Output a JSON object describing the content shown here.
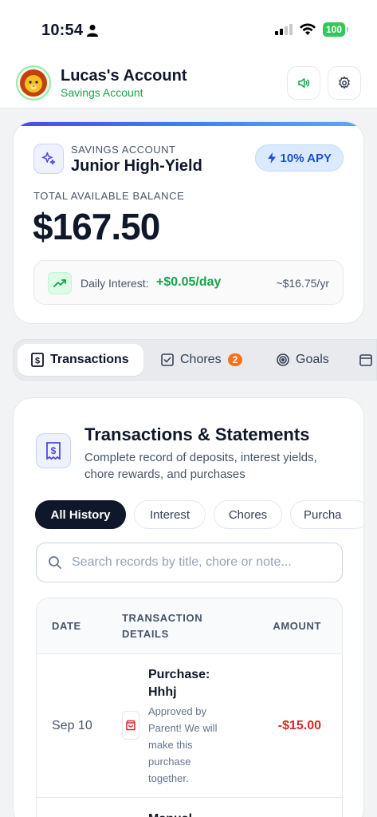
{
  "status_bar": {
    "time": "10:54",
    "battery": "100"
  },
  "header": {
    "account_name": "Lucas's Account",
    "account_type": "Savings Account"
  },
  "balance_card": {
    "label": "SAVINGS ACCOUNT",
    "name": "Junior High-Yield",
    "apy": "10% APY",
    "balance_label": "TOTAL AVAILABLE BALANCE",
    "balance": "$167.50",
    "daily_interest_label": "Daily Interest:",
    "daily_interest_value": "+$0.05/day",
    "yearly": "~$16.75/yr"
  },
  "tabs": [
    {
      "label": "Transactions",
      "active": true
    },
    {
      "label": "Chores",
      "badge": "2"
    },
    {
      "label": "Goals"
    }
  ],
  "transactions": {
    "title": "Transactions & Statements",
    "subtitle": "Complete record of deposits, interest yields, chore rewards, and purchases",
    "filters": [
      "All History",
      "Interest",
      "Chores",
      "Purcha"
    ],
    "search_placeholder": "Search records by title, chore or note...",
    "columns": {
      "date": "DATE",
      "details_1": "TRANSACTION",
      "details_2": "DETAILS",
      "amount": "AMOUNT"
    },
    "rows": [
      {
        "date": "Sep 10",
        "title_1": "Purchase:",
        "title_2": "Hhhj",
        "note": [
          "Approved by",
          "Parent! We will",
          "make this",
          "purchase",
          "together."
        ],
        "amount": "-$15.00"
      },
      {
        "title_1": "Manual"
      }
    ]
  }
}
